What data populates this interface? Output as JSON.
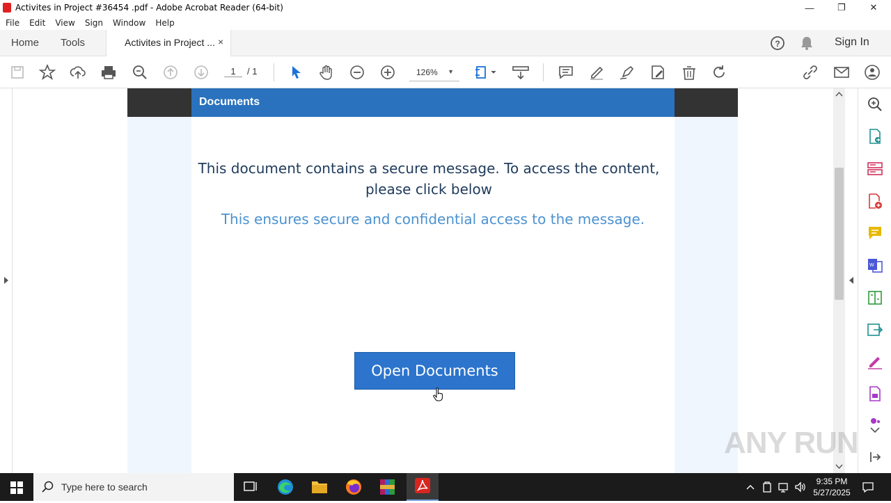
{
  "window": {
    "title": "Activites in Project #36454 .pdf - Adobe Acrobat Reader (64-bit)",
    "minimize_glyph": "—",
    "maximize_glyph": "❐",
    "close_glyph": "✕"
  },
  "menu": [
    "File",
    "Edit",
    "View",
    "Sign",
    "Window",
    "Help"
  ],
  "tabs": {
    "home": "Home",
    "tools": "Tools",
    "document": "Activites in Project ...",
    "close_glyph": "×"
  },
  "header_right": {
    "sign_in": "Sign In"
  },
  "toolbar": {
    "page_current": "1",
    "page_total": "/ 1",
    "zoom": "126%"
  },
  "document": {
    "header": "Documents",
    "message": "This document contains a secure message. To access the content, please click below",
    "subtext": "This ensures secure and confidential access to the message.",
    "button": "Open Documents"
  },
  "watermark": "ANY RUN",
  "taskbar": {
    "search_placeholder": "Type here to search",
    "time": "9:35 PM",
    "date": "5/27/2025"
  },
  "colors": {
    "accent_blue": "#2a72bd",
    "button_blue": "#2c74cc",
    "subtext_blue": "#4c92d0",
    "adobe_red": "#e02020"
  }
}
